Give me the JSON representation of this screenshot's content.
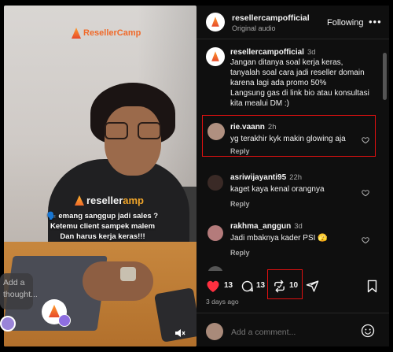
{
  "video": {
    "brand_logo_text": "ResellerCamp",
    "shirt_logo_prefix": "reseller",
    "shirt_logo_suffix": "amp",
    "caption_lines": [
      "🗣️ emang sanggup jadi sales ?",
      "Ketemu client sampek malem",
      "Dan harus kerja keras!!!"
    ],
    "thought_placeholder": "Add a thought...",
    "mute_icon": "speaker-muted-icon"
  },
  "post": {
    "username": "resellercampofficial",
    "audio": "Original audio",
    "follow_label": "Following",
    "more_icon": "ellipsis-icon"
  },
  "comments": [
    {
      "username": "resellercampofficial",
      "time": "3d",
      "text_lines": [
        "Jangan ditanya soal kerja keras,",
        "tanyalah soal cara jadi reseller domain",
        "karena lagi ada promo 50%",
        "Langsung gas di link bio atau konsultasi",
        "kita mealui DM :)"
      ]
    },
    {
      "username": "rie.vaann",
      "time": "2h",
      "text": "yg terakhir kyk makin glowing aja",
      "reply_label": "Reply",
      "highlighted": true
    },
    {
      "username": "asriwijayanti95",
      "time": "22h",
      "text": "kaget kaya kenal orangnya",
      "reply_label": "Reply"
    },
    {
      "username": "rakhma_anggun",
      "time": "3d",
      "text": "Jadi mbaknya kader PSI 🫣",
      "reply_label": "Reply"
    }
  ],
  "actions": {
    "likes": "13",
    "comments": "13",
    "reposts": "10",
    "time_ago": "3 days ago"
  },
  "add_comment": {
    "placeholder": "Add a comment..."
  },
  "colors": {
    "highlight": "#e01010",
    "like_red": "#ff3040",
    "panel_bg": "#0f0f0f",
    "brand_orange": "#f06a2a"
  }
}
